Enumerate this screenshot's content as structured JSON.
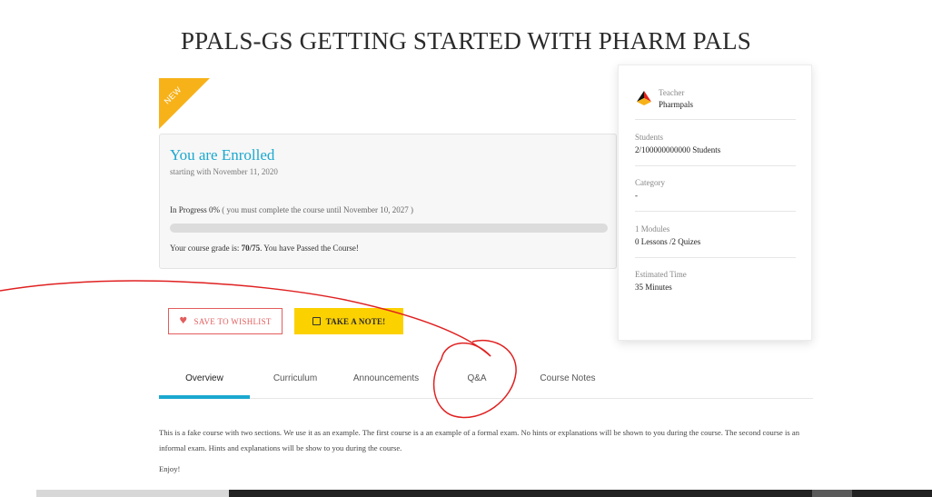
{
  "page": {
    "title": "PPALS-GS GETTING STARTED WITH PHARM PALS"
  },
  "badge": {
    "label": "NEW",
    "color": "#f7b21a"
  },
  "enrollment": {
    "title": "You are Enrolled",
    "start": "starting with November 11, 2020",
    "progress_label": "In Progress 0%",
    "progress_note": "( you must complete the course until November 10, 2027 )",
    "progress_fraction": 0,
    "grade_prefix": "Your course grade is: ",
    "grade_value": "70/75",
    "grade_suffix": ". You have Passed the Course!",
    "accent_color": "#1ba8cf"
  },
  "info": {
    "teacher_label": "Teacher",
    "teacher_name": "Pharmpals",
    "students_label": "Students",
    "students_value": "2/100000000000 Students",
    "category_label": "Category",
    "category_value": "-",
    "modules_label": "1 Modules",
    "modules_value": "0 Lessons /2 Quizes",
    "time_label": "Estimated Time",
    "time_value": "35 Minutes"
  },
  "actions": {
    "wishlist_label": "SAVE TO WISHLIST",
    "wishlist_icon": "heart-icon",
    "note_label": "TAKE A NOTE!",
    "note_icon": "note-icon",
    "note_color": "#fcd100",
    "wishlist_color": "#e35d5d"
  },
  "tabs": [
    {
      "label": "Overview",
      "active": true
    },
    {
      "label": "Curriculum",
      "active": false
    },
    {
      "label": "Announcements",
      "active": false
    },
    {
      "label": "Q&A",
      "active": false
    },
    {
      "label": "Course Notes",
      "active": false
    }
  ],
  "overview": {
    "description": "This is a fake course with two sections. We use it as an example. The first course is a an example of a formal exam. No hints or explanations will be shown to you during the course. The second course is an informal exam. Hints and explanations will be show to you during the course.",
    "closing": "Enjoy!"
  }
}
